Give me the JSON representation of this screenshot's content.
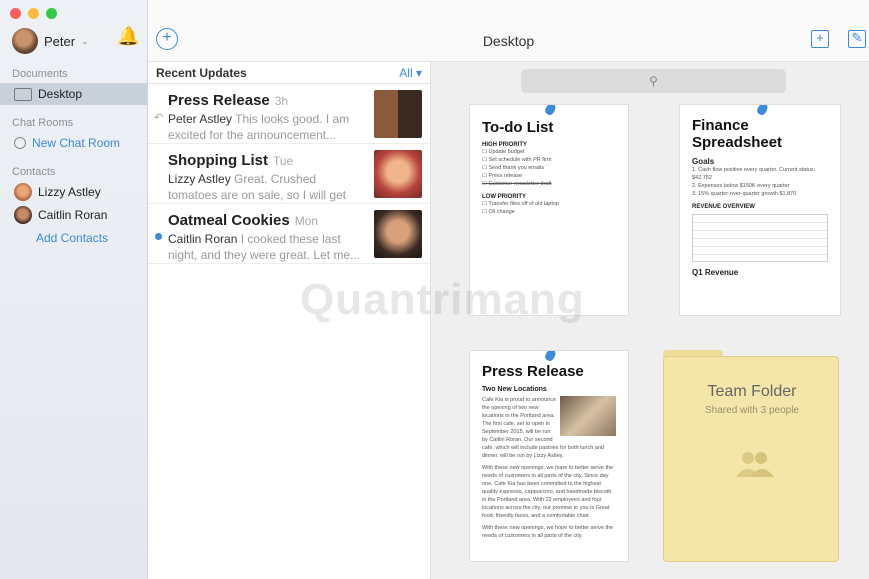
{
  "sidebar": {
    "user_name": "Peter",
    "sections": {
      "documents": "Documents",
      "chat_rooms": "Chat Rooms",
      "contacts": "Contacts"
    },
    "desktop_label": "Desktop",
    "new_chat_room": "New Chat Room",
    "contacts": [
      "Lizzy Astley",
      "Caitlin Roran"
    ],
    "add_contacts": "Add Contacts"
  },
  "topbar": {
    "title": "Desktop"
  },
  "list": {
    "header": "Recent Updates",
    "filter": "All",
    "items": [
      {
        "title": "Press Release",
        "when": "3h",
        "author": "Peter Astley",
        "snippet": " This looks good. I am excited for the announcement..."
      },
      {
        "title": "Shopping List",
        "when": "Tue",
        "author": "Lizzy Astley",
        "snippet": " Great. Crushed tomatoes are on sale, so I will get those."
      },
      {
        "title": "Oatmeal Cookies",
        "when": "Mon",
        "author": "Caitlin Roran",
        "snippet": " I cooked these last night, and they were great. Let me..."
      }
    ]
  },
  "docs": {
    "todo": {
      "title": "To-do List",
      "high": "HIGH PRIORITY",
      "high_items": [
        "Update budget",
        "Set schedule with PR firm",
        "Send thank you emails",
        "Press release",
        "Customer newsletter draft"
      ],
      "low": "LOW PRIORITY",
      "low_items": [
        "Transfer files off of old laptop",
        "Oil change"
      ]
    },
    "finance": {
      "title": "Finance Spreadsheet",
      "goals": "Goals",
      "goal_items": [
        "1. Cash flow positive every quarter. Current status: $42,752",
        "2. Expenses below $150K every quarter",
        "3. 15% quarter-over-quarter growth $1,870"
      ],
      "rev": "REVENUE OVERVIEW",
      "q1": "Q1 Revenue"
    },
    "press": {
      "title": "Press Release",
      "sub": "Two New Locations",
      "p1": "Cafe Kia is proud to announce the opening of two new locations in the Portland area. The first cafe, set to open in September 2015, will be run by Caitlin Roran. Our second cafe, which will include pastries for both lunch and dinner, will be run by Lizzy Astley.",
      "p2": "With these new openings, we hope to better serve the needs of customers in all parts of the city. Since day one, Cafe Kia has been committed to the highest quality espresso, cappuccino, and handmade biscotti in the Portland area. With 22 employees and four locations across the city, our promise to you is Great food, friendly faces, and a comfortable chair.",
      "p3": "With these new openings, we hope to better serve the needs of customers in all parts of the city."
    },
    "folder": {
      "title": "Team Folder",
      "shared": "Shared with 3 people"
    }
  },
  "watermark": "Quantrimang"
}
